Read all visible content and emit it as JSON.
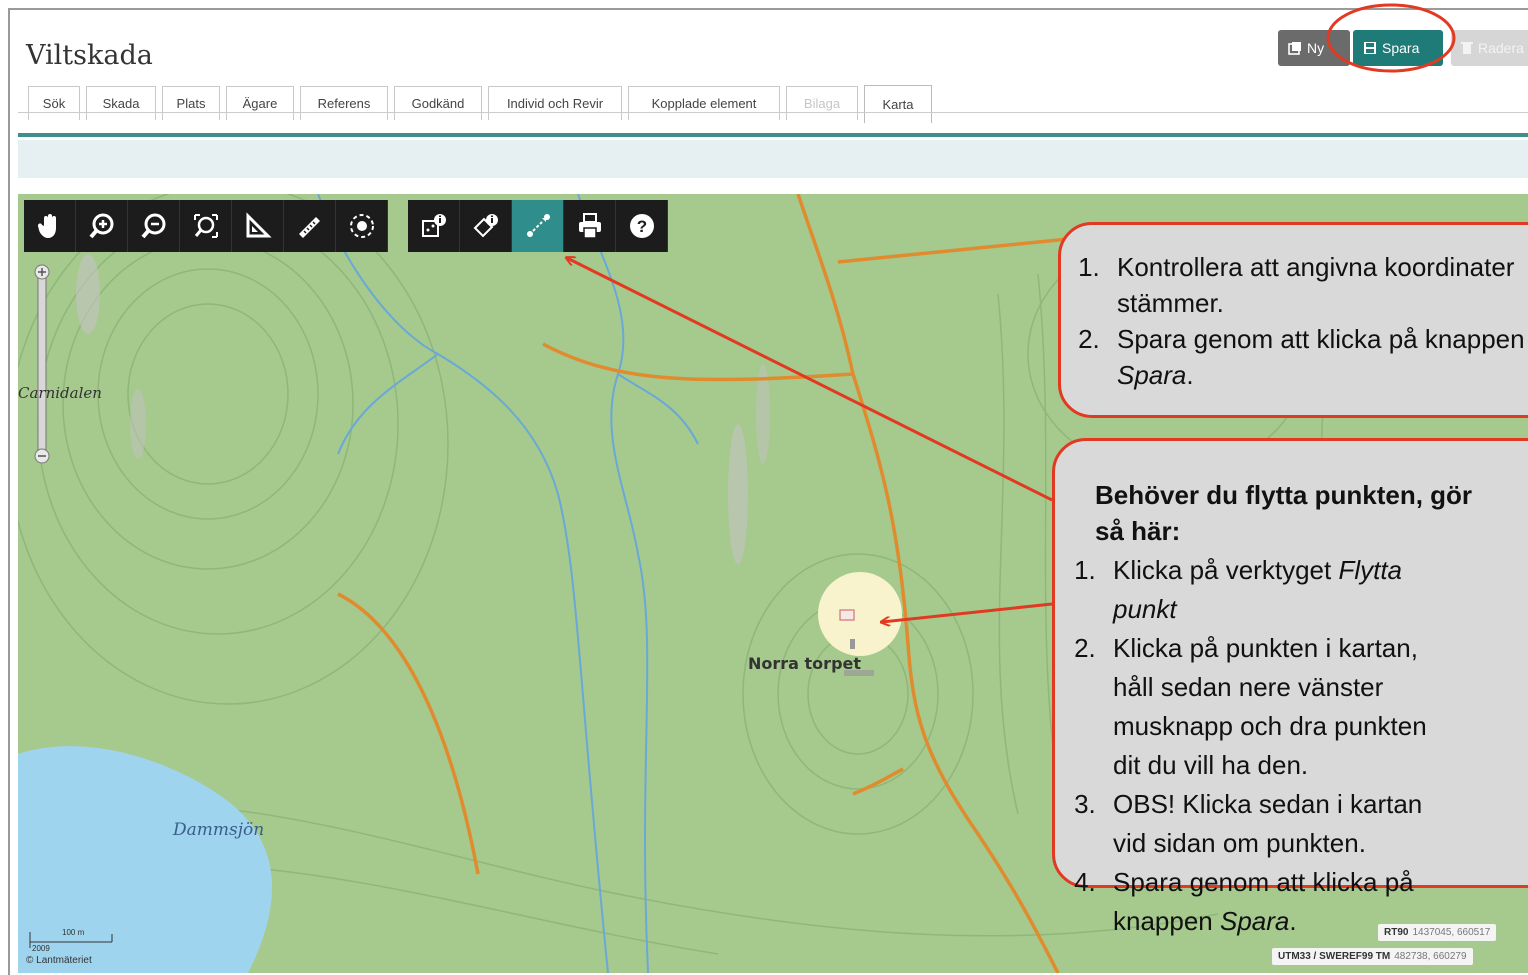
{
  "app": {
    "title": "Viltskada"
  },
  "toolbar_buttons": {
    "ny": "Ny",
    "spara": "Spara",
    "radera": "Radera"
  },
  "tabs": [
    {
      "label": "Sök",
      "state": "normal"
    },
    {
      "label": "Skada",
      "state": "normal"
    },
    {
      "label": "Plats",
      "state": "normal"
    },
    {
      "label": "Ägare",
      "state": "normal"
    },
    {
      "label": "Referens",
      "state": "normal"
    },
    {
      "label": "Godkänd",
      "state": "normal"
    },
    {
      "label": "Individ och Revir",
      "state": "normal"
    },
    {
      "label": "Kopplade element",
      "state": "normal"
    },
    {
      "label": "Bilaga",
      "state": "disabled"
    },
    {
      "label": "Karta",
      "state": "active"
    }
  ],
  "map": {
    "labels": {
      "place1": "Carnidalen",
      "place2": "Norra torpet",
      "lake": "Dammsjön"
    },
    "tools": [
      {
        "name": "pan-hand-icon"
      },
      {
        "name": "zoom-in-icon"
      },
      {
        "name": "zoom-out-icon"
      },
      {
        "name": "zoom-extent-icon"
      },
      {
        "name": "measure-area-icon"
      },
      {
        "name": "measure-line-icon"
      },
      {
        "name": "select-area-icon"
      },
      {
        "name": "info-point-icon"
      },
      {
        "name": "info-area-icon"
      },
      {
        "name": "move-point-icon",
        "active": true
      },
      {
        "name": "print-icon"
      },
      {
        "name": "help-icon"
      }
    ],
    "scale": {
      "distance": "100 m",
      "year": "2009",
      "credit": "© Lantmäteriet"
    },
    "coords": [
      {
        "system": "RT90",
        "value": "1437045, 660517"
      },
      {
        "system": "UTM33 / SWEREF99 TM",
        "value": "482738, 660279"
      }
    ],
    "colors": {
      "land": "#a6c98d",
      "water": "#9fd4ef",
      "road": "#e08c2e",
      "stream": "#6aa8d8",
      "accent": "#1e7b78",
      "callout_border": "#e23a22"
    }
  },
  "callout1": {
    "steps": [
      "Kontrollera att angivna koordinater stämmer.",
      "Spara genom att klicka på knappen"
    ],
    "emphasis": "Spara"
  },
  "callout2": {
    "heading": "Behöver du flytta punkten, gör så här:",
    "step1_pre": "Klicka på verktyget ",
    "step1_em": "Flytta punkt",
    "step2": "Klicka på punkten i kartan, håll sedan nere vänster musknapp och dra punkten dit du vill ha den.",
    "step3": "OBS! Klicka sedan i kartan vid sidan om punkten.",
    "step4_pre": "Spara genom att klicka på knappen ",
    "step4_em": "Spara"
  }
}
